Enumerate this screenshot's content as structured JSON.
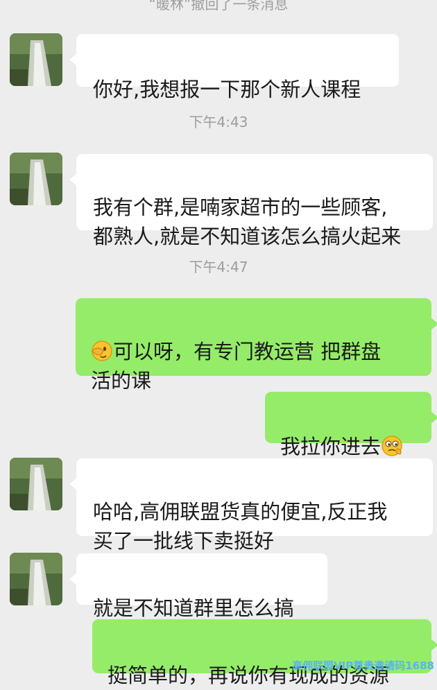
{
  "system_notices": {
    "recall": "“暖林”撤回了一条消息",
    "time_1": "下午4:43",
    "time_2": "下午4:47"
  },
  "messages": [
    {
      "side": "in",
      "text": "你好,我想报一下那个新人课程"
    },
    {
      "side": "in",
      "text": "我有个群,是喃家超市的一些顾客,\n都熟人,就是不知道该怎么搞火起来"
    },
    {
      "side": "out",
      "emoji": "facepalm-emoji",
      "text": "可以呀，有专门教运营 把群盘\n活的课"
    },
    {
      "side": "out",
      "text": "我拉你进去",
      "emoji": "thinking-emoji"
    },
    {
      "side": "in",
      "text": "哈哈,高佣联盟货真的便宜,反正我\n买了一批线下卖挺好"
    },
    {
      "side": "in",
      "text": "就是不知道群里怎么搞"
    },
    {
      "side": "out",
      "text": "挺简单的，再说你有现成的资源"
    }
  ],
  "watermark": "高佣联盟VIP尊贵邀请码1688",
  "colors": {
    "background": "#ededed",
    "incoming_bubble": "#ffffff",
    "outgoing_bubble": "#95ec69",
    "system_text": "#9d9d9d",
    "watermark": "#5ab4ec"
  }
}
